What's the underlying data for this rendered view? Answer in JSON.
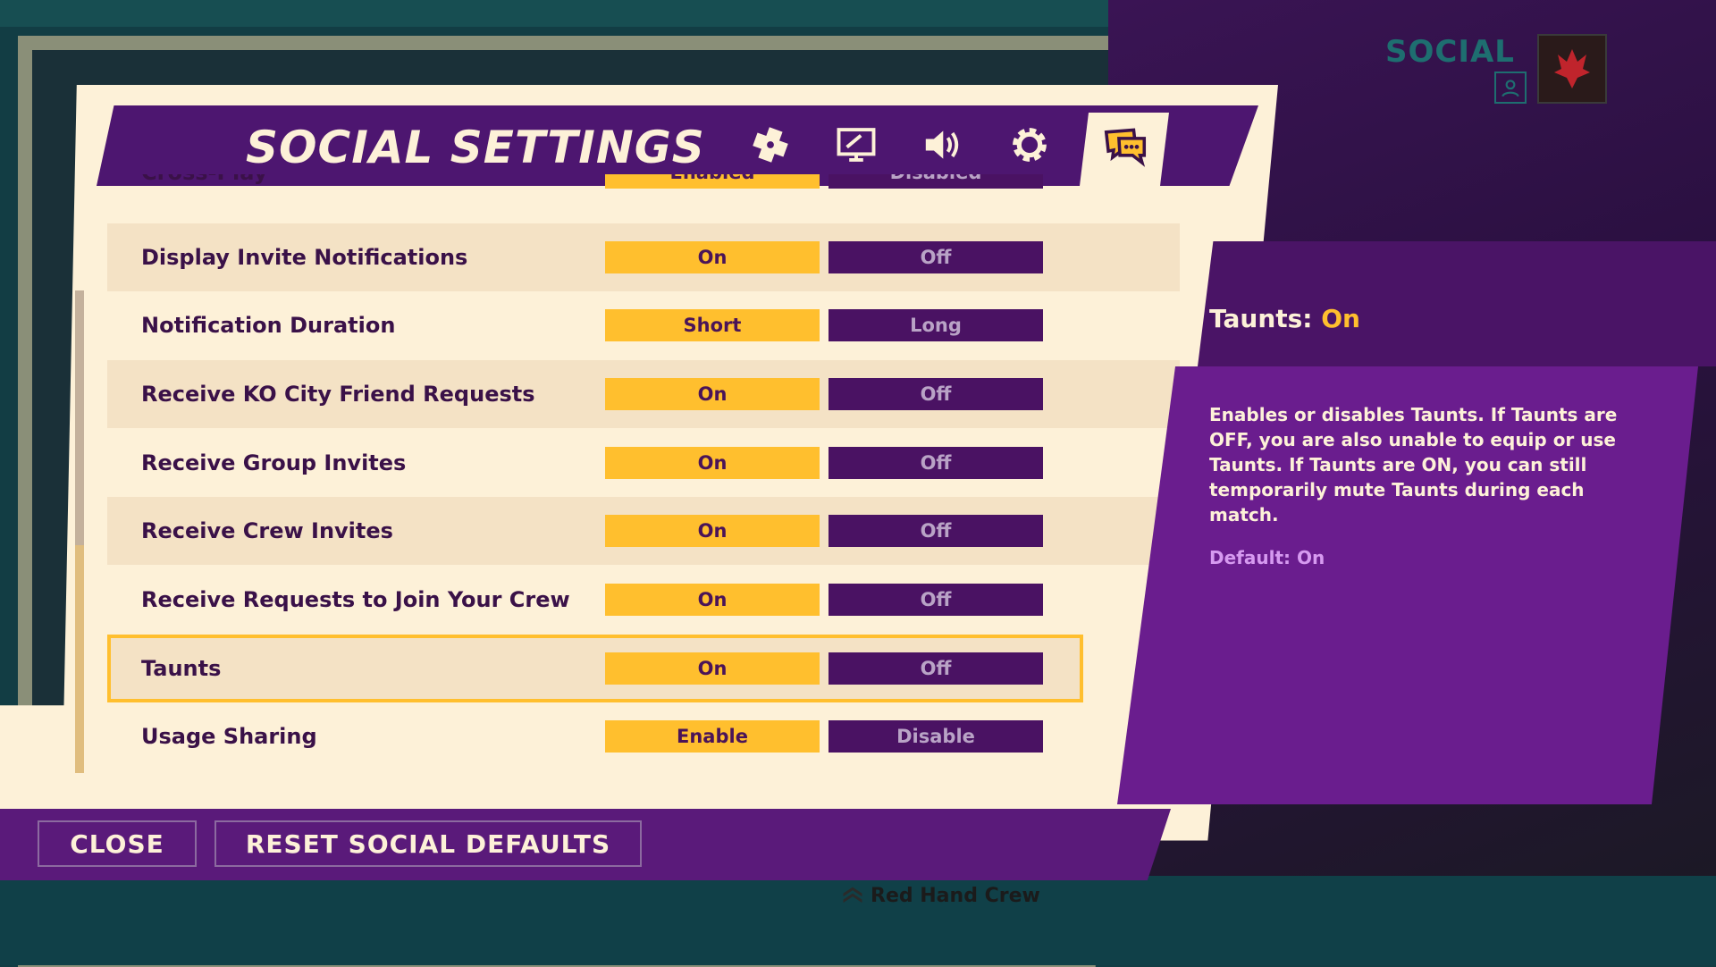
{
  "title": "SOCIAL SETTINGS",
  "corner_logo": "SOCIAL",
  "tabs": [
    {
      "icon": "gamepad-icon"
    },
    {
      "icon": "display-icon"
    },
    {
      "icon": "speaker-icon"
    },
    {
      "icon": "gear-icon"
    },
    {
      "icon": "chat-icon",
      "active": true
    }
  ],
  "rows": [
    {
      "label": "Cross-Play",
      "on": "Enabled",
      "off": "Disabled"
    },
    {
      "label": "Display Invite Notifications",
      "on": "On",
      "off": "Off"
    },
    {
      "label": "Notification Duration",
      "on": "Short",
      "off": "Long"
    },
    {
      "label": "Receive KO City Friend Requests",
      "on": "On",
      "off": "Off"
    },
    {
      "label": "Receive Group Invites",
      "on": "On",
      "off": "Off"
    },
    {
      "label": "Receive Crew Invites",
      "on": "On",
      "off": "Off"
    },
    {
      "label": "Receive Requests to Join Your Crew",
      "on": "On",
      "off": "Off"
    },
    {
      "label": "Taunts",
      "on": "On",
      "off": "Off"
    },
    {
      "label": "Usage Sharing",
      "on": "Enable",
      "off": "Disable"
    }
  ],
  "buttons": {
    "close": "CLOSE",
    "reset": "RESET SOCIAL DEFAULTS"
  },
  "description": {
    "heading_label": "Taunts:",
    "heading_value": "On",
    "body": "Enables or disables Taunts. If Taunts are OFF, you are also unable to equip or use Taunts. If Taunts are ON, you can still temporarily mute Taunts during each match.",
    "default": "Default: On"
  },
  "crew_name": "Red Hand Crew",
  "colors": {
    "accent": "#ffbf2e",
    "purple": "#4d1670",
    "panel": "#fdf1d8"
  }
}
